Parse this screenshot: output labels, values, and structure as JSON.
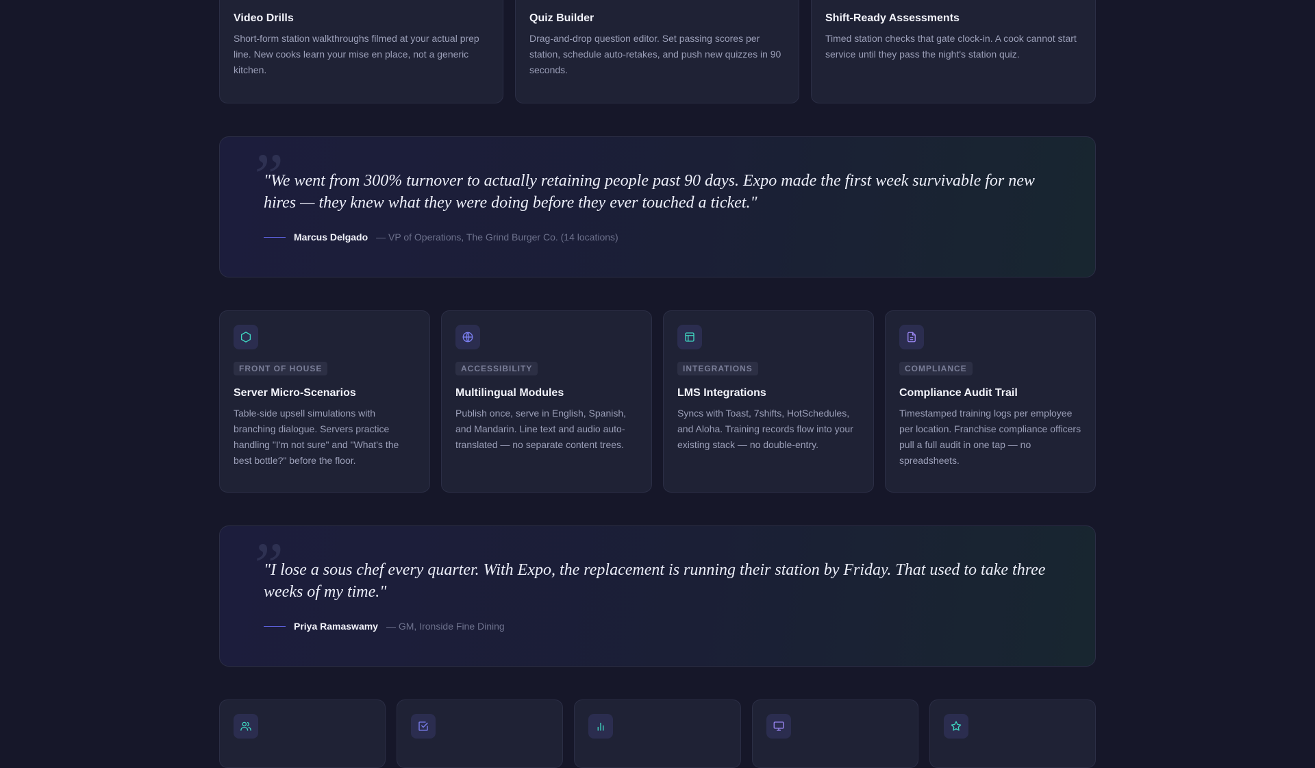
{
  "top_cards": [
    {
      "title": "Video Drills",
      "desc": "Short-form station walkthroughs filmed at your actual prep line. New cooks learn your mise en place, not a generic kitchen."
    },
    {
      "title": "Quiz Builder",
      "desc": "Drag-and-drop question editor. Set passing scores per station, schedule auto-retakes, and push new quizzes in 90 seconds."
    },
    {
      "title": "Shift-Ready Assessments",
      "desc": "Timed station checks that gate clock-in. A cook cannot start service until they pass the night's station quiz."
    }
  ],
  "quotes": [
    {
      "mark": "”",
      "text": "\"We went from 300% turnover to actually retaining people past 90 days. Expo made the first week survivable for new hires — they knew what they were doing before they ever touched a ticket.\"",
      "name": "Marcus Delgado",
      "role": "— VP of Operations, The Grind Burger Co. (14 locations)"
    },
    {
      "mark": "”",
      "text": "\"I lose a sous chef every quarter. With Expo, the replacement is running their station by Friday. That used to take three weeks of my time.\"",
      "name": "Priya Ramaswamy",
      "role": "— GM, Ironside Fine Dining"
    }
  ],
  "features": [
    {
      "icon": "hexagon-icon",
      "tag": "FRONT OF HOUSE",
      "title": "Server Micro-Scenarios",
      "desc": "Table-side upsell simulations with branching dialogue. Servers practice handling \"I'm not sure\" and \"What's the best bottle?\" before the floor."
    },
    {
      "icon": "globe-icon",
      "tag": "ACCESSIBILITY",
      "title": "Multilingual Modules",
      "desc": "Publish once, serve in English, Spanish, and Mandarin. Line text and audio auto-translated — no separate content trees."
    },
    {
      "icon": "layout-icon",
      "tag": "INTEGRATIONS",
      "title": "LMS Integrations",
      "desc": "Syncs with Toast, 7shifts, HotSchedules, and Aloha. Training records flow into your existing stack — no double-entry."
    },
    {
      "icon": "document-icon",
      "tag": "COMPLIANCE",
      "title": "Compliance Audit Trail",
      "desc": "Timestamped training logs per employee per location. Franchise compliance officers pull a full audit in one tap — no spreadsheets."
    }
  ],
  "bottom_icons": [
    "users-icon",
    "checkbox-icon",
    "bar-chart-icon",
    "monitor-icon",
    "star-icon"
  ],
  "colors": {
    "teal": "#3fd6c1",
    "indigo": "#7b7ff0",
    "violet": "#9a86f2"
  }
}
